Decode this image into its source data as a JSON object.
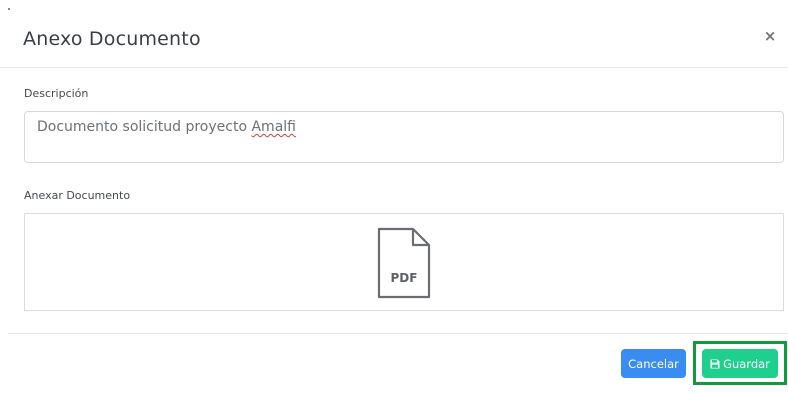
{
  "dialog": {
    "title": "Anexo Documento",
    "close_glyph": "×"
  },
  "form": {
    "description_label": "Descripción",
    "description_value_main": "Documento solicitud proyecto ",
    "description_value_misspelled": "Amalfi",
    "attach_label": "Anexar Documento",
    "file_type_text": "PDF",
    "file_icon": "pdf-file-icon"
  },
  "footer": {
    "cancel_label": "Cancelar",
    "save_label": "Guardar",
    "save_icon": "floppy-disk-icon"
  },
  "colors": {
    "cancel_button": "#3b8cf0",
    "save_button": "#1ecf8e",
    "highlight_border": "#0f9a3c"
  }
}
